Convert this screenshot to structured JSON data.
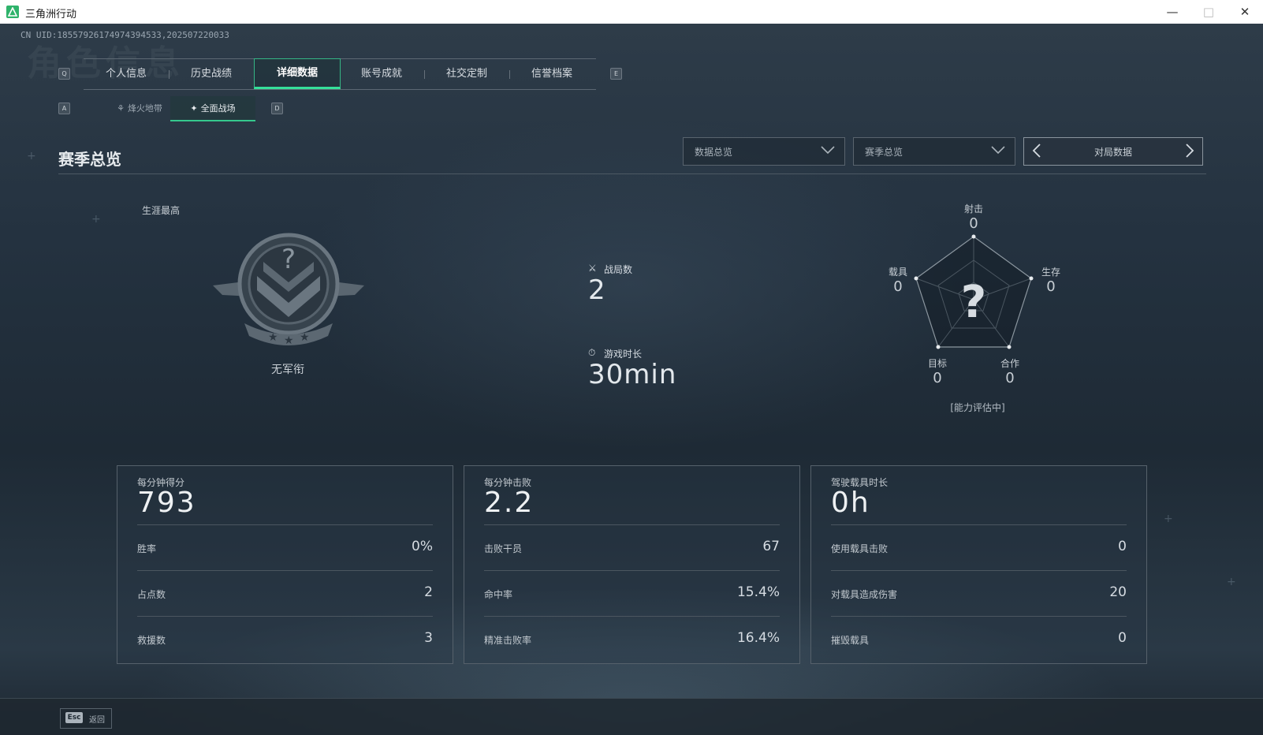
{
  "window": {
    "title": "三角洲行动"
  },
  "header": {
    "uid": "CN UID:18557926174974394533,202507220033",
    "watermark": "角色信息"
  },
  "keys": {
    "prev_tab": "Q",
    "next_tab": "E",
    "prev_sub": "A",
    "next_sub": "D"
  },
  "tabs": [
    {
      "label": "个人信息"
    },
    {
      "label": "历史战绩"
    },
    {
      "label": "详细数据"
    },
    {
      "label": "账号成就"
    },
    {
      "label": "社交定制"
    },
    {
      "label": "信誉档案"
    }
  ],
  "subtabs": [
    {
      "label": "烽火地带"
    },
    {
      "label": "全面战场"
    }
  ],
  "section": {
    "title": "赛季总览"
  },
  "filters": {
    "dropdown1": "数据总览",
    "dropdown2": "赛季总览",
    "pager": "对局数据"
  },
  "rank": {
    "career_label": "生涯最高",
    "name": "无军衔",
    "emblem_mark": "?"
  },
  "summary": {
    "matches_label": "战局数",
    "matches_value": "2",
    "time_label": "游戏时长",
    "time_value": "30min"
  },
  "radar": {
    "center": "?",
    "note": "[能力评估中]",
    "axes": [
      {
        "label": "射击",
        "value": "0"
      },
      {
        "label": "生存",
        "value": "0"
      },
      {
        "label": "合作",
        "value": "0"
      },
      {
        "label": "目标",
        "value": "0"
      },
      {
        "label": "载具",
        "value": "0"
      }
    ]
  },
  "cards": [
    {
      "head": "每分钟得分",
      "big": "793",
      "rows": [
        {
          "k": "胜率",
          "v": "0%"
        },
        {
          "k": "占点数",
          "v": "2"
        },
        {
          "k": "救援数",
          "v": "3"
        }
      ]
    },
    {
      "head": "每分钟击败",
      "big": "2.2",
      "rows": [
        {
          "k": "击败干员",
          "v": "67"
        },
        {
          "k": "命中率",
          "v": "15.4%"
        },
        {
          "k": "精准击败率",
          "v": "16.4%"
        }
      ]
    },
    {
      "head": "驾驶载具时长",
      "big": "0h",
      "rows": [
        {
          "k": "使用载具击败",
          "v": "0"
        },
        {
          "k": "对载具造成伤害",
          "v": "20"
        },
        {
          "k": "摧毁载具",
          "v": "0"
        }
      ]
    }
  ],
  "footer": {
    "esc_key": "Esc",
    "esc_label": "返回"
  },
  "colors": {
    "accent": "#35e09a",
    "panel_border": "#56616b"
  }
}
